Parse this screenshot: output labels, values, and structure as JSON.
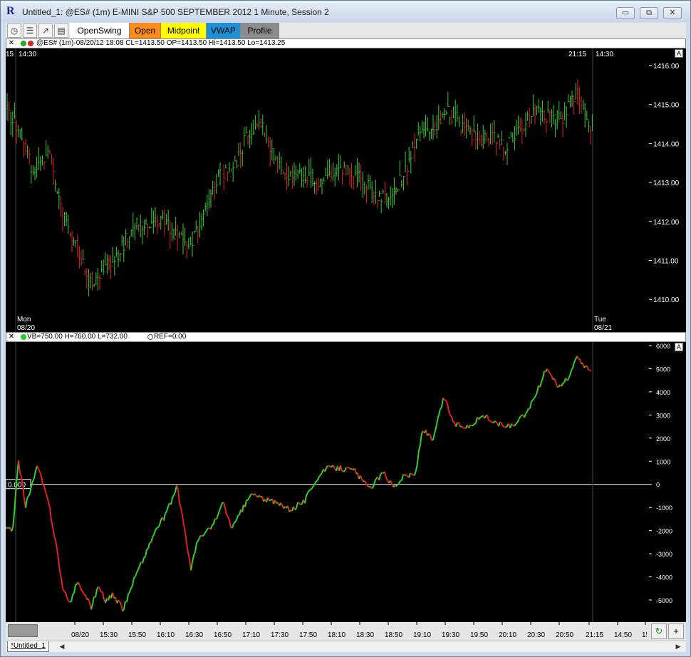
{
  "window": {
    "title": "Untitled_1: @ES# (1m) E-MINI S&P 500 SEPTEMBER 2012 1 Minute, Session 2",
    "app_icon": "R",
    "minimize": "▭",
    "restore": "⧉",
    "close": "✕"
  },
  "toolbar": {
    "icons": [
      "clock-icon",
      "stack-icon",
      "chart-icon",
      "list-icon"
    ],
    "buttons": [
      {
        "label": "OpenSwing",
        "color": "#ffffff"
      },
      {
        "label": "Open",
        "color": "#ff8c1a"
      },
      {
        "label": "Midpoint",
        "color": "#ffff00"
      },
      {
        "label": "VWAP",
        "color": "#1e90d6"
      },
      {
        "label": "Profile",
        "color": "#8c8c8c"
      }
    ]
  },
  "price_pane": {
    "header": "@ES# (1m)-08/20/12 18:08 CL=1413.50 OP=1413.50 Hi=1413.50 Lo=1413.25",
    "top_left_label": "15",
    "top_time_left": "14:30",
    "top_time_right_a": "21:15",
    "top_time_right_b": "14:30",
    "day_left": "Mon",
    "date_left": "08/20",
    "day_right": "Tue",
    "date_right": "08/21",
    "axis_button": "A",
    "y_ticks": [
      "1416.00",
      "1415.00",
      "1414.00",
      "1413.00",
      "1412.00",
      "1411.00",
      "1410.00"
    ]
  },
  "indicator_pane": {
    "header": "VB=750.00 H=760.00 L=732.00",
    "header_ref": "REF=0.00",
    "axis_button": "A",
    "zero_label": "0.000",
    "y_ticks": [
      "6000",
      "5000",
      "4000",
      "3000",
      "2000",
      "1000",
      "0",
      "-1000",
      "-2000",
      "-3000",
      "-4000",
      "-5000"
    ]
  },
  "time_axis": {
    "labels": [
      "08/20",
      "15:30",
      "15:50",
      "16:10",
      "16:30",
      "16:50",
      "17:10",
      "17:30",
      "17:50",
      "18:10",
      "18:30",
      "18:50",
      "19:10",
      "19:30",
      "19:50",
      "20:10",
      "20:30",
      "20:50",
      "21:15",
      "14:50",
      "15"
    ]
  },
  "bottom": {
    "refresh_icon": "↻",
    "plus": "+"
  },
  "status": {
    "tab_label": "*Untitled_1",
    "tab_prev": "◀",
    "tab_next": "▶"
  },
  "colors": {
    "up": "#33cc33",
    "down": "#e02020",
    "grid_line": "#ffffff",
    "axis_text": "#ffffff",
    "background": "#000000"
  }
}
